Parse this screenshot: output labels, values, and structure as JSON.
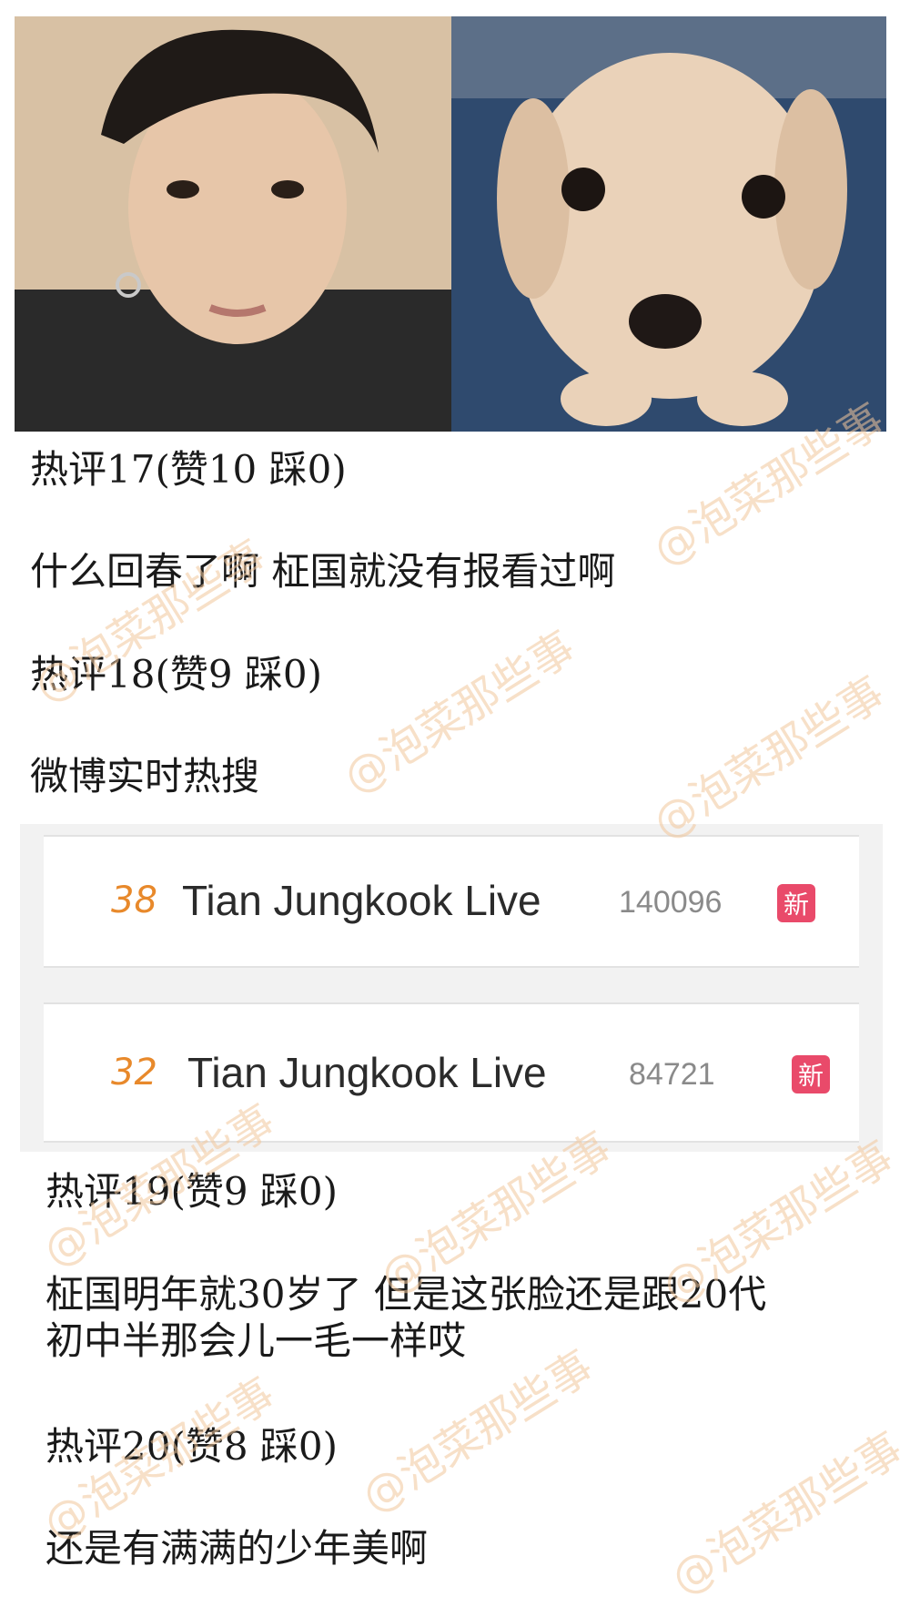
{
  "comments": [
    {
      "header": "热评17(赞10 踩0)",
      "body": [
        "什么回春了啊 柾国就没有报看过啊"
      ]
    },
    {
      "header": "热评18(赞9 踩0)",
      "body": [
        "微博实时热搜"
      ]
    },
    {
      "header": "热评19(赞9 踩0)",
      "body": [
        "柾国明年就30岁了 但是这张脸还是跟20代",
        "初中半那会儿一毛一样哎"
      ]
    },
    {
      "header": "热评20(赞8 踩0)",
      "body": [
        "还是有满满的少年美啊"
      ]
    }
  ],
  "hot_search": [
    {
      "rank": "38",
      "title": "Tian Jungkook Live",
      "count": "140096",
      "badge": "新"
    },
    {
      "rank": "32",
      "title": "Tian Jungkook Live",
      "count": "84721",
      "badge": "新"
    }
  ],
  "watermark": "@泡菜那些事",
  "colors": {
    "rank": "#e8892b",
    "badge": "#e94a6a",
    "watermark": "#f2c79c"
  }
}
